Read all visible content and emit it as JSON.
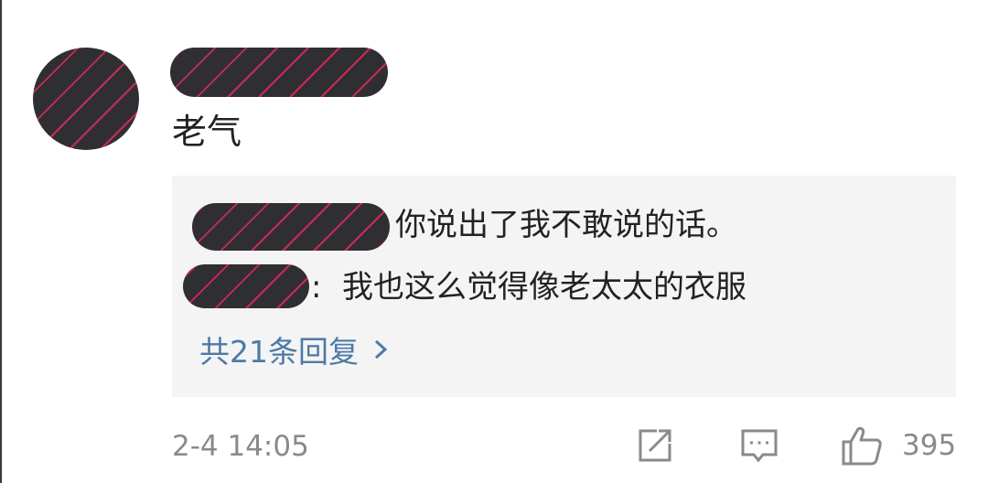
{
  "comment": {
    "text": "老气",
    "timestamp": "2-4 14:05"
  },
  "replies": [
    {
      "separator": "",
      "text": "你说出了我不敢说的话。"
    },
    {
      "separator": ":",
      "text": "我也这么觉得像老太太的衣服"
    }
  ],
  "more_replies": {
    "label": "共21条回复",
    "icon": "chevron-right-icon"
  },
  "actions": {
    "share_icon": "share-icon",
    "comment_icon": "comment-icon",
    "like_icon": "thumbs-up-icon",
    "like_count": "395"
  },
  "colors": {
    "link": "#4d7aa6",
    "secondary_text": "#8a8a8a",
    "reply_background": "#f4f4f4"
  }
}
